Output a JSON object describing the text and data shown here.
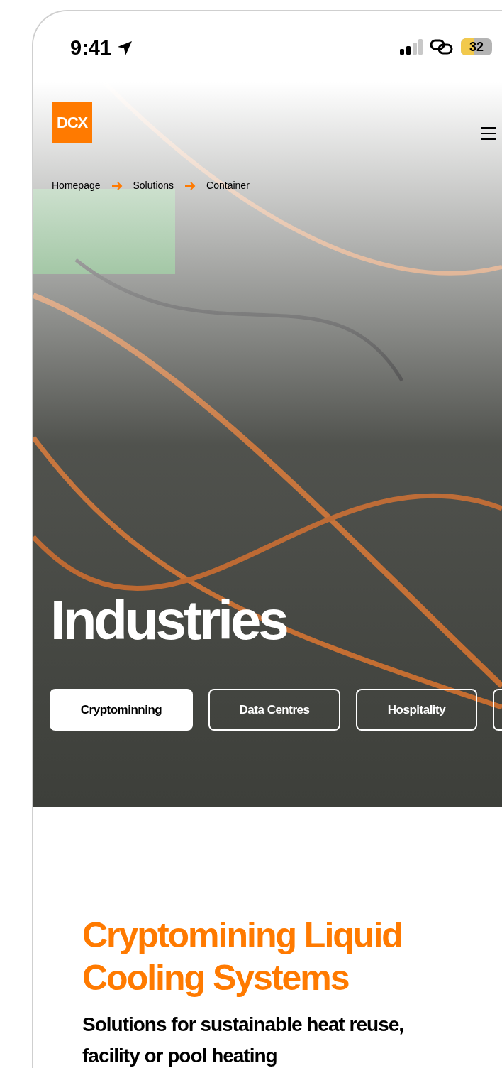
{
  "status_bar": {
    "time": "9:41",
    "battery": "32"
  },
  "header": {
    "logo": "DCX"
  },
  "breadcrumb": [
    {
      "label": "Homepage"
    },
    {
      "label": "Solutions"
    },
    {
      "label": "Container"
    }
  ],
  "hero": {
    "title": "Industries",
    "tabs": [
      {
        "label": "Cryptominning",
        "selected": true
      },
      {
        "label": "Data Centres",
        "selected": false
      },
      {
        "label": "Hospitality",
        "selected": false
      },
      {
        "selected": false
      }
    ]
  },
  "section": {
    "title": "Cryptomining Liquid Cooling Systems",
    "subtitle": "Solutions for sustainable heat reuse, facility or pool heating"
  }
}
